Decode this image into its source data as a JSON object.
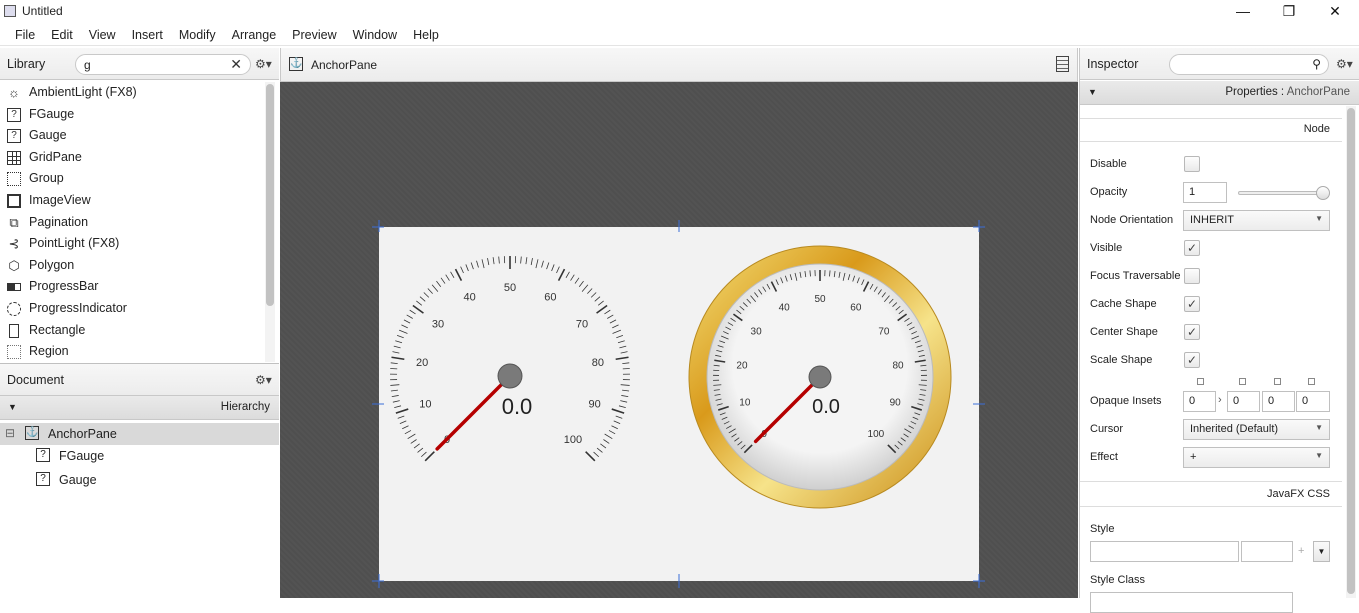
{
  "window": {
    "title": "Untitled",
    "minimize": "—",
    "maximize": "❐",
    "close": "✕"
  },
  "menu": [
    "File",
    "Edit",
    "View",
    "Insert",
    "Modify",
    "Arrange",
    "Preview",
    "Window",
    "Help"
  ],
  "library": {
    "title": "Library",
    "search_value": "g",
    "clear": "✕",
    "settings": "⚙▾",
    "items": [
      {
        "label": "AmbientLight  (FX8)",
        "icon": "sun-icon"
      },
      {
        "label": "FGauge",
        "icon": "unknown-component-icon"
      },
      {
        "label": "Gauge",
        "icon": "unknown-component-icon"
      },
      {
        "label": "GridPane",
        "icon": "grid-icon"
      },
      {
        "label": "Group",
        "icon": "group-icon"
      },
      {
        "label": "ImageView",
        "icon": "image-icon"
      },
      {
        "label": "Pagination",
        "icon": "pagination-icon"
      },
      {
        "label": "PointLight  (FX8)",
        "icon": "pointlight-icon"
      },
      {
        "label": "Polygon",
        "icon": "polygon-icon"
      },
      {
        "label": "ProgressBar",
        "icon": "progressbar-icon"
      },
      {
        "label": "ProgressIndicator",
        "icon": "progressindicator-icon"
      },
      {
        "label": "Rectangle",
        "icon": "rectangle-icon"
      },
      {
        "label": "Region",
        "icon": "region-icon"
      }
    ]
  },
  "document": {
    "title": "Document",
    "settings": "⚙▾",
    "hierarchy_label": "Hierarchy",
    "tree": [
      {
        "label": "AnchorPane",
        "icon": "anchor-icon",
        "expand": "⊟"
      },
      {
        "label": "FGauge",
        "icon": "unknown-component-icon"
      },
      {
        "label": "Gauge",
        "icon": "unknown-component-icon"
      }
    ]
  },
  "canvas": {
    "breadcrumb": "AnchorPane",
    "gauge1": {
      "value": "0.0",
      "ticks": [
        "0",
        "10",
        "20",
        "30",
        "40",
        "50",
        "60",
        "70",
        "80",
        "90",
        "100"
      ],
      "needle_value": 0
    },
    "gauge2": {
      "value": "0.0",
      "ticks": [
        "0",
        "10",
        "20",
        "30",
        "40",
        "50",
        "60",
        "70",
        "80",
        "90",
        "100"
      ],
      "needle_value": 0
    }
  },
  "inspector": {
    "title": "Inspector",
    "settings": "⚙▾",
    "properties_prefix": "Properties : ",
    "properties_target": "AnchorPane",
    "section_node": "Node",
    "props": {
      "disable": "Disable",
      "opacity": "Opacity",
      "opacity_value": "1",
      "node_orientation": "Node Orientation",
      "node_orientation_value": "INHERIT",
      "visible": "Visible",
      "focus_traversable": "Focus Traversable",
      "cache_shape": "Cache Shape",
      "center_shape": "Center Shape",
      "scale_shape": "Scale Shape",
      "opaque_insets": "Opaque Insets",
      "insets": [
        "0",
        "0",
        "0",
        "0"
      ],
      "cursor": "Cursor",
      "cursor_value": "Inherited (Default)",
      "effect": "Effect",
      "effect_value": "+"
    },
    "checks": {
      "disable": false,
      "visible": true,
      "focus_traversable": false,
      "cache_shape": true,
      "center_shape": true,
      "scale_shape": true
    },
    "section_css": "JavaFX CSS",
    "style": "Style",
    "style_class": "Style Class",
    "plus": "+"
  }
}
